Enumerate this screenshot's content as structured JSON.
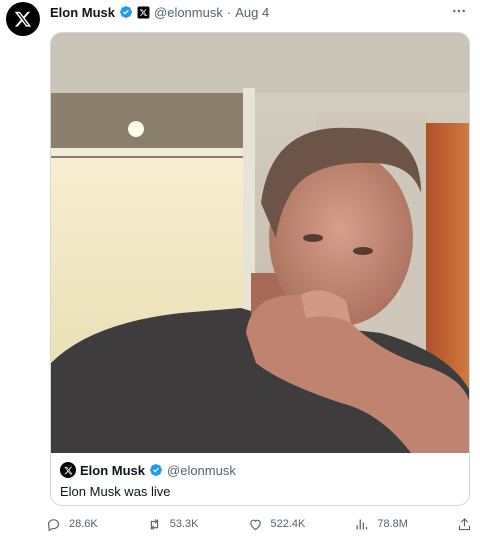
{
  "tweet": {
    "author_name": "Elon Musk",
    "handle": "@elonmusk",
    "separator": "·",
    "date": "Aug 4"
  },
  "quote": {
    "author_name": "Elon Musk",
    "handle": "@elonmusk",
    "text": "Elon Musk was live"
  },
  "actions": {
    "replies": "28.6K",
    "reposts": "53.3K",
    "likes": "522.4K",
    "views": "78.8M"
  },
  "icons": {
    "avatar": "x-logo-icon",
    "verified": "verified-badge-icon",
    "affiliate": "x-affiliate-icon",
    "more": "more-icon",
    "reply": "reply-icon",
    "repost": "repost-icon",
    "like": "heart-icon",
    "views": "views-icon",
    "share": "share-icon"
  },
  "colors": {
    "verified": "#1d9bf0",
    "text_secondary": "#536471",
    "border": "#cfd9de"
  }
}
